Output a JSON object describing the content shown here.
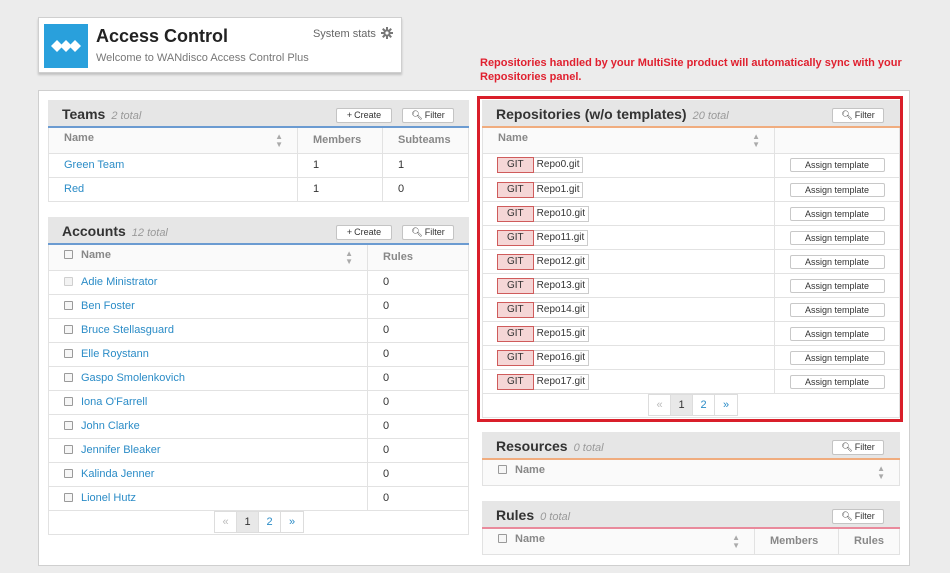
{
  "header": {
    "title": "Access Control",
    "subtitle": "Welcome to WANdisco Access Control Plus",
    "system_stats_label": "System stats",
    "logo_icon": "wandisco-logo-icon",
    "gear_icon": "gear-icon"
  },
  "notice": {
    "text": "Repositories handled by your MultiSite product will automatically sync with your Repositories panel."
  },
  "teams": {
    "title": "Teams",
    "count": "2 total",
    "create_label": "Create",
    "filter_label": "Filter",
    "columns": [
      "Name",
      "Members",
      "Subteams"
    ],
    "rows": [
      {
        "name": "Green Team",
        "members": "1",
        "subteams": "1"
      },
      {
        "name": "Red",
        "members": "1",
        "subteams": "0"
      }
    ]
  },
  "accounts": {
    "title": "Accounts",
    "count": "12 total",
    "create_label": "Create",
    "filter_label": "Filter",
    "columns": [
      "Name",
      "Rules"
    ],
    "rows": [
      {
        "name": "Adie Ministrator",
        "rules": "0"
      },
      {
        "name": "Ben Foster",
        "rules": "0"
      },
      {
        "name": "Bruce Stellasguard",
        "rules": "0"
      },
      {
        "name": "Elle Roystann",
        "rules": "0"
      },
      {
        "name": "Gaspo Smolenkovich",
        "rules": "0"
      },
      {
        "name": "Iona O'Farrell",
        "rules": "0"
      },
      {
        "name": "John Clarke",
        "rules": "0"
      },
      {
        "name": "Jennifer Bleaker",
        "rules": "0"
      },
      {
        "name": "Kalinda Jenner",
        "rules": "0"
      },
      {
        "name": "Lionel Hutz",
        "rules": "0"
      }
    ],
    "pager": [
      "«",
      "1",
      "2",
      "»"
    ]
  },
  "repositories": {
    "title": "Repositories (w/o templates)",
    "count": "20 total",
    "filter_label": "Filter",
    "columns": [
      "Name"
    ],
    "badge": "GIT",
    "assign_label": "Assign template",
    "rows": [
      "Repo0.git",
      "Repo1.git",
      "Repo10.git",
      "Repo11.git",
      "Repo12.git",
      "Repo13.git",
      "Repo14.git",
      "Repo15.git",
      "Repo16.git",
      "Repo17.git"
    ],
    "pager": [
      "«",
      "1",
      "2",
      "»"
    ]
  },
  "resources": {
    "title": "Resources",
    "count": "0 total",
    "filter_label": "Filter",
    "columns": [
      "Name"
    ]
  },
  "rules": {
    "title": "Rules",
    "count": "0 total",
    "filter_label": "Filter",
    "columns": [
      "Name",
      "Members",
      "Rules"
    ]
  },
  "colors": {
    "accent": "#29a0dc",
    "link": "#2b8cc7",
    "notice": "#e0202f",
    "highlight": "#d91f2a"
  }
}
